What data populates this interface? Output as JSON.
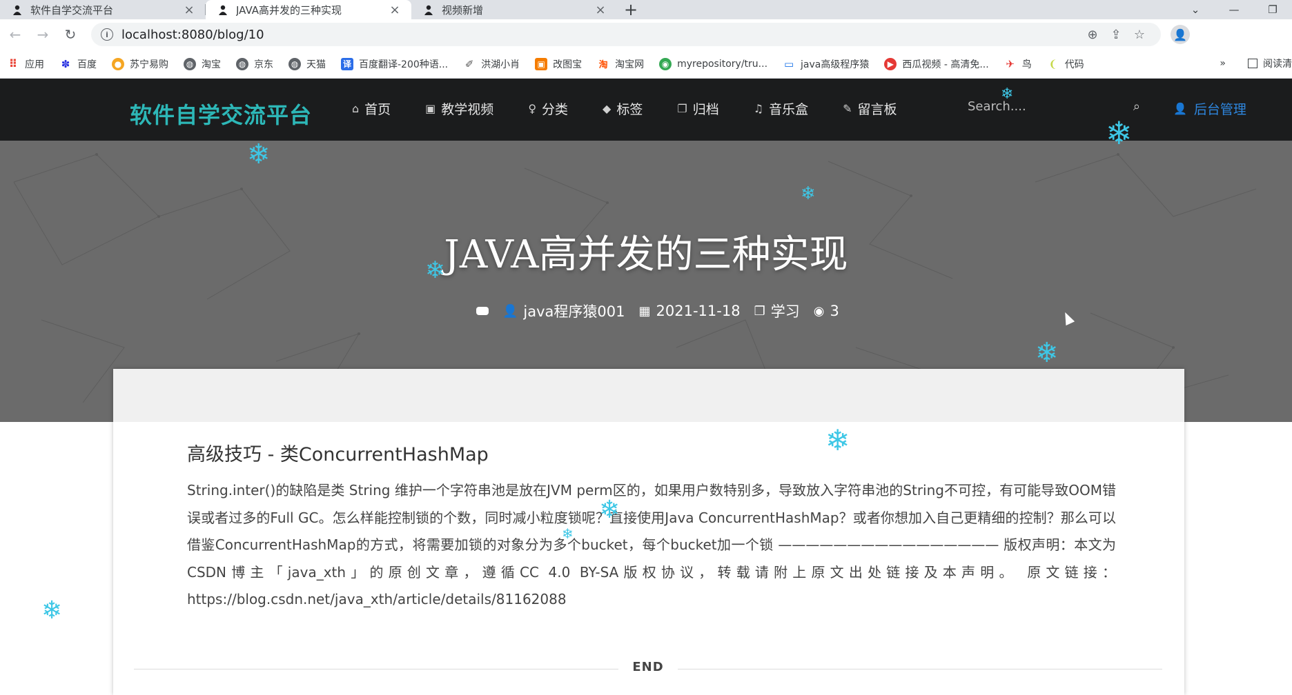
{
  "browser": {
    "tabs": [
      {
        "title": "软件自学交流平台",
        "active": false
      },
      {
        "title": "JAVA高并发的三种实现",
        "active": true
      },
      {
        "title": "视频新增",
        "active": false
      }
    ],
    "url": "localhost:8080/blog/10",
    "bookmarks": [
      {
        "label": "应用",
        "color": "#e94235"
      },
      {
        "label": "百度",
        "color": "#2932e1"
      },
      {
        "label": "苏宁易购",
        "color": "#f5a623"
      },
      {
        "label": "淘宝",
        "color": "#5f6368"
      },
      {
        "label": "京东",
        "color": "#5f6368"
      },
      {
        "label": "天猫",
        "color": "#5f6368"
      },
      {
        "label": "百度翻译-200种语...",
        "color": "#2b6de8"
      },
      {
        "label": "洪湖小肖",
        "color": "#888888"
      },
      {
        "label": "改图宝",
        "color": "#f57c00"
      },
      {
        "label": "淘宝网",
        "color": "#ff5000"
      },
      {
        "label": "myrepository/tru...",
        "color": "#34a853"
      },
      {
        "label": "java高级程序猿",
        "color": "#1a73e8"
      },
      {
        "label": "西瓜视频 - 高清免...",
        "color": "#e53935"
      },
      {
        "label": "鸟",
        "color": "#e53935"
      },
      {
        "label": "代码",
        "color": "#c6d94a"
      }
    ],
    "bookmarks_more": "»",
    "reading_list": "阅读清"
  },
  "nav": {
    "brand": "软件自学交流平台",
    "items": [
      {
        "label": "首页",
        "icon": "⌂",
        "icon_name": "home-icon"
      },
      {
        "label": "教学视频",
        "icon": "▣",
        "icon_name": "image-icon"
      },
      {
        "label": "分类",
        "icon": "♀",
        "icon_name": "lightbulb-icon"
      },
      {
        "label": "标签",
        "icon": "◆",
        "icon_name": "tags-icon"
      },
      {
        "label": "归档",
        "icon": "❐",
        "icon_name": "clone-icon"
      },
      {
        "label": "音乐盒",
        "icon": "♫",
        "icon_name": "music-icon"
      },
      {
        "label": "留言板",
        "icon": "✎",
        "icon_name": "book-icon"
      }
    ],
    "search_placeholder": "Search....",
    "admin_label": "后台管理"
  },
  "hero": {
    "title": "JAVA高并发的三种实现",
    "author": "java程序猿001",
    "date": "2021-11-18",
    "category": "学习",
    "views": "3"
  },
  "article": {
    "heading": "高级技巧 - 类ConcurrentHashMap",
    "body": "String.inter()的缺陷是类 String 维护一个字符串池是放在JVM perm区的，如果用户数特别多，导致放入字符串池的String不可控，有可能导致OOM错误或者过多的Full GC。怎么样能控制锁的个数，同时减小粒度锁呢？直接使用Java ConcurrentHashMap？或者你想加入自己更精细的控制？那么可以借鉴ConcurrentHashMap的方式，将需要加锁的对象分为多个bucket，每个bucket加一个锁 ———————————————— 版权声明：本文为CSDN博主「java_xth」的原创文章，遵循CC 4.0 BY-SA版权协议，转载请附上原文出处链接及本声明。 原文链接：https://blog.csdn.net/java_xth/article/details/81162088",
    "end_label": "END"
  },
  "colors": {
    "navbar": "#1b1c1d",
    "brand": "#2db7b7",
    "admin": "#2e86de",
    "hero": "#6b6b6b",
    "snowflake": "#3ec7e6"
  }
}
